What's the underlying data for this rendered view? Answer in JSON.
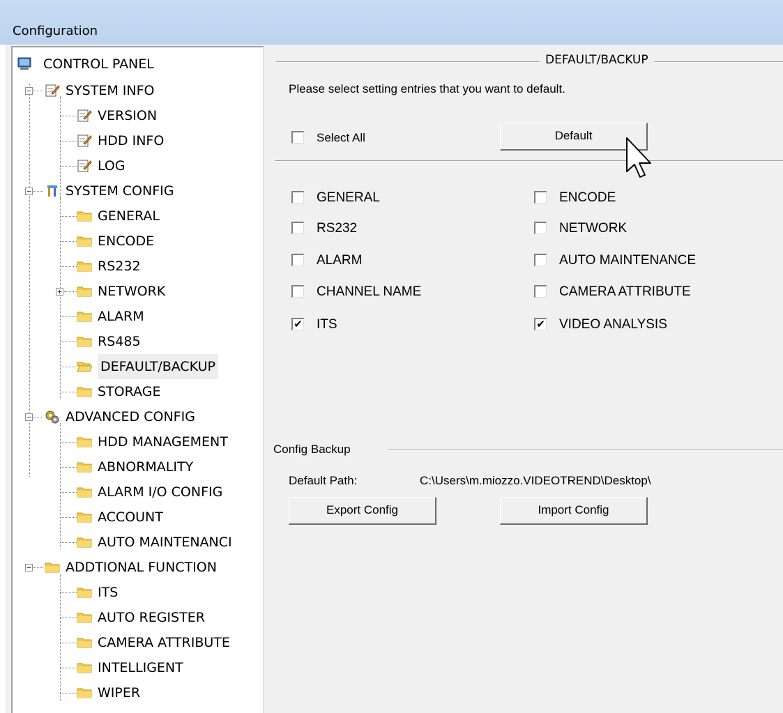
{
  "window": {
    "title": "Configuration"
  },
  "tree": {
    "root": "CONTROL PANEL",
    "system_info": {
      "label": "SYSTEM INFO",
      "children": [
        "VERSION",
        "HDD INFO",
        "LOG"
      ]
    },
    "system_config": {
      "label": "SYSTEM CONFIG",
      "children": [
        "GENERAL",
        "ENCODE",
        "RS232",
        "NETWORK",
        "ALARM",
        "RS485",
        "DEFAULT/BACKUP",
        "STORAGE"
      ]
    },
    "advanced_config": {
      "label": "ADVANCED CONFIG",
      "children": [
        "HDD MANAGEMENT",
        "ABNORMALITY",
        "ALARM I/O CONFIG",
        "ACCOUNT",
        "AUTO MAINTENANCI"
      ]
    },
    "additional_function": {
      "label": "ADDTIONAL FUNCTION",
      "children": [
        "ITS",
        "AUTO REGISTER",
        "CAMERA ATTRIBUTE",
        "INTELLIGENT",
        "WIPER"
      ]
    },
    "selected": "DEFAULT/BACKUP"
  },
  "default_backup": {
    "group_title": "DEFAULT/BACKUP",
    "instruction": "Please select setting entries that you want to default.",
    "select_all": {
      "label": "Select All",
      "checked": false
    },
    "default_button": "Default",
    "entries": [
      {
        "label": "GENERAL",
        "checked": false
      },
      {
        "label": "ENCODE",
        "checked": false
      },
      {
        "label": "RS232",
        "checked": false
      },
      {
        "label": "NETWORK",
        "checked": false
      },
      {
        "label": "ALARM",
        "checked": false
      },
      {
        "label": "AUTO MAINTENANCE",
        "checked": false
      },
      {
        "label": "CHANNEL NAME",
        "checked": false
      },
      {
        "label": "CAMERA ATTRIBUTE",
        "checked": false
      },
      {
        "label": "ITS",
        "checked": true
      },
      {
        "label": "VIDEO ANALYSIS",
        "checked": true
      }
    ]
  },
  "config_backup": {
    "group_title": "Config Backup",
    "path_label": "Default Path:",
    "path_value": "C:\\Users\\m.miozzo.VIDEOTREND\\Desktop\\",
    "export_button": "Export Config",
    "import_button": "Import Config"
  },
  "icons": {
    "control_panel": "computer-icon",
    "system_info": "notepad-icon",
    "system_config": "tools-icon",
    "advanced_config": "gears-icon",
    "folder": "folder-icon",
    "checkmark": "✔",
    "cursor": "arrow-cursor-icon"
  },
  "colors": {
    "titlebar": "#c2d7f0",
    "panel": "#f0f0f0",
    "folder": "#f2c94c",
    "selected_bg": "#ededed"
  }
}
